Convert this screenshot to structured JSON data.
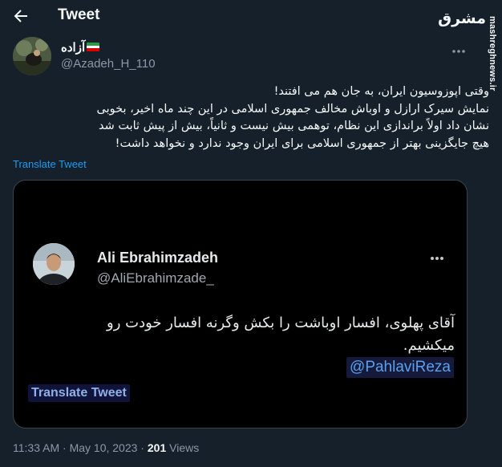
{
  "header": {
    "title": "Tweet"
  },
  "watermark": {
    "logo": "مشرق",
    "site": "mashreghnews.ir"
  },
  "author": {
    "display_name": "آزاده",
    "handle": "@Azadeh_H_110"
  },
  "tweet": {
    "lines": [
      "وقتی اپوزوسیون ایران، به جان هم می افتند!",
      "نمایش سیرک ارازل و اوباش مخالف جمهوری اسلامی در این چند ماه اخیر، بخوبی",
      "نشان داد اولاً براندازی این نظام، توهمی بیش نیست و ثانیاً، بیش از پیش ثابت شد",
      "هیچ جایگزینی بهتر از جمهوری اسلامی برای ایران وجود ندارد و نخواهد داشت!"
    ],
    "translate_label": "Translate Tweet"
  },
  "embedded": {
    "name": "Ali Ebrahimzadeh",
    "handle": "@AliEbrahimzade_",
    "lines": [
      "آقای پهلوی، افسار اوباشت را بکش وگرنه افسار خودت رو",
      "میکشیم."
    ],
    "mention": "@PahlaviReza",
    "translate_label": "Translate Tweet"
  },
  "meta": {
    "time": "11:33 AM",
    "separator": " · ",
    "date": "May 10, 2023",
    "views_count": "201",
    "views_label": "Views"
  },
  "colors": {
    "background": "#15202b",
    "accent": "#1d9bf0",
    "secondary_text": "#8b98a5",
    "border": "#38444d"
  }
}
